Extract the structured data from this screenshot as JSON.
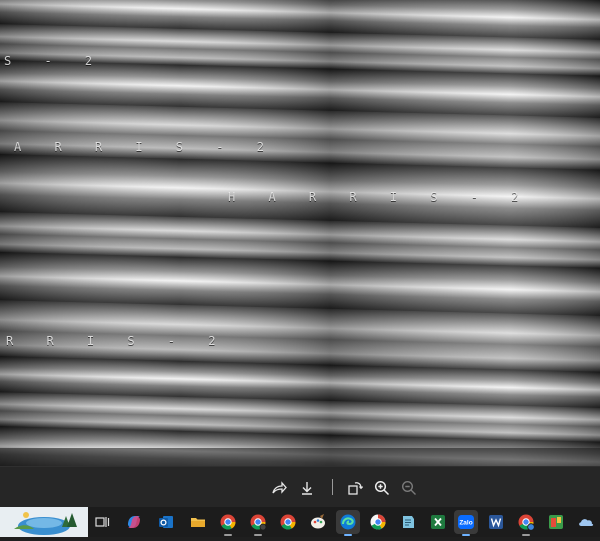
{
  "photo": {
    "stamps": [
      {
        "text": "S - 2"
      },
      {
        "text": "A R R I S - 2"
      },
      {
        "text": "H A R R I S - 2"
      },
      {
        "text": "R R I S - 2"
      }
    ]
  },
  "toolbar": {
    "buttons": [
      "share-icon",
      "download-icon",
      "rotate-icon",
      "zoom-in-icon",
      "zoom-out-icon"
    ]
  },
  "taskbar": {
    "items": [
      "weather-widget",
      "task-view-icon",
      "copilot-icon",
      "outlook-icon",
      "file-explorer-icon",
      "chrome-icon",
      "chrome-profile-icon",
      "chrome-icon",
      "paint-icon",
      "edge-icon",
      "brave-icon",
      "notepad-icon",
      "excel-icon",
      "zalo-icon",
      "word-icon",
      "chrome-icon",
      "app-icon",
      "cloud-icon"
    ],
    "zalo_label": "Zalo"
  },
  "colors": {
    "toolbar_bg": "#262626",
    "taskbar_bg": "#1c1c1c",
    "accent_excel": "#1f7a3f",
    "accent_word": "#2b579a",
    "accent_edge": "#0f7bd8"
  }
}
